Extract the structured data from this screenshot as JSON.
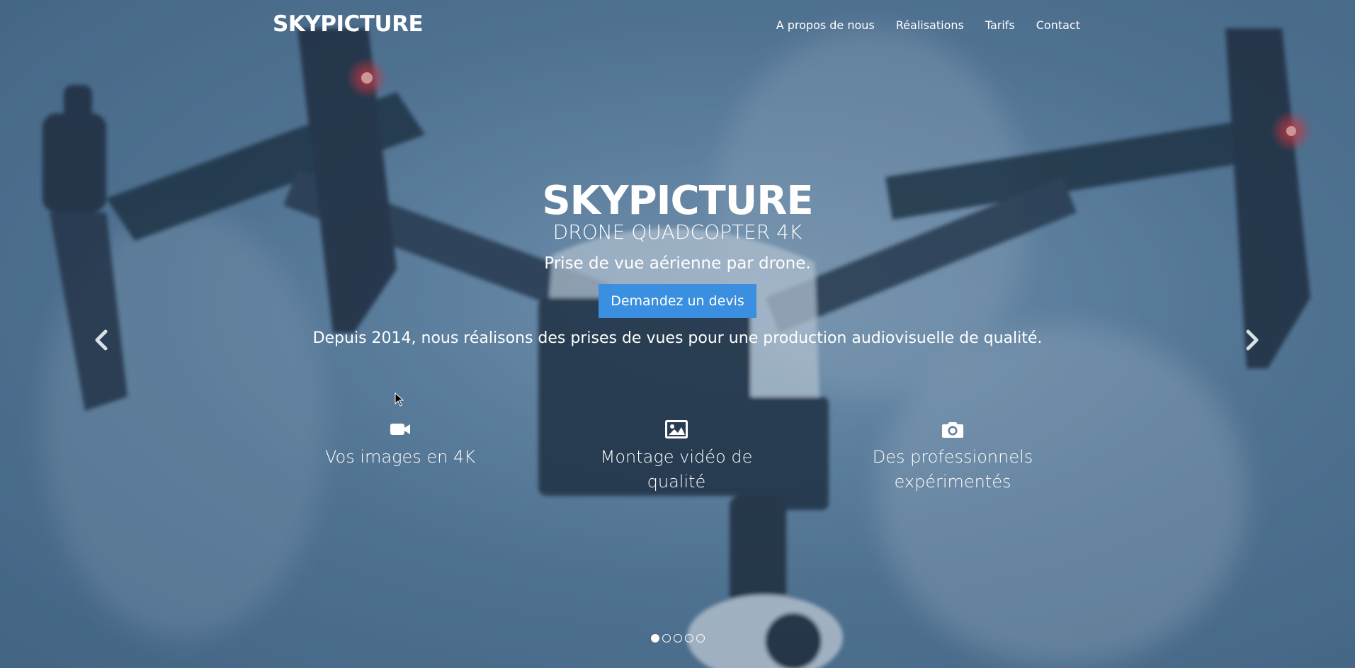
{
  "navbar": {
    "brand": "SKYPICTURE",
    "links": [
      "A propos de nous",
      "Réalisations",
      "Tarifs",
      "Contact"
    ]
  },
  "hero": {
    "title": "SKYPICTURE",
    "subtitle": "DRONE QUADCOPTER 4K",
    "tagline": "Prise de vue aérienne par drone.",
    "cta_label": "Demandez un devis",
    "description": "Depuis 2014, nous réalisons des prises de vues pour une production audiovisuelle de qualité."
  },
  "features": [
    {
      "icon": "video-camera-icon",
      "text": "Vos images en 4K"
    },
    {
      "icon": "image-icon",
      "text": "Montage vidéo de qualité"
    },
    {
      "icon": "camera-icon",
      "text": "Des professionnels expérimentés"
    }
  ],
  "carousel": {
    "slide_count": 5,
    "active_index": 0
  },
  "colors": {
    "accent": "#3a8fe0",
    "text": "#ffffff",
    "overlay": "#4d6c88"
  }
}
